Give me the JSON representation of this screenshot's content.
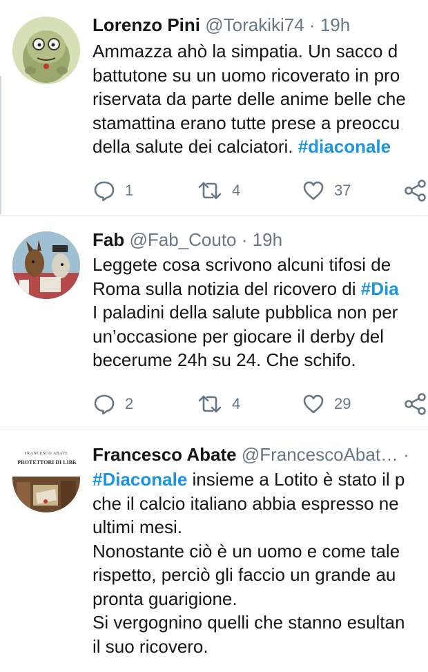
{
  "tweets": [
    {
      "name": "Lorenzo Pini",
      "handle": "@Torakiki74",
      "sep": "·",
      "time": "19h",
      "lines": [
        [
          "Ammazza ahò la simpatia. Un sacco d"
        ],
        [
          "battutone su un uomo ricoverato in pro"
        ],
        [
          "riservata da parte delle anime belle che"
        ],
        [
          "stamattina erano tutte prese a preoccu"
        ],
        [
          "della salute dei calciatori. ",
          "#diaconale"
        ]
      ],
      "replies": "1",
      "retweets": "4",
      "likes": "37"
    },
    {
      "name": "Fab",
      "handle": "@Fab_Couto",
      "sep": "·",
      "time": "19h",
      "lines": [
        [
          "Leggete cosa scrivono alcuni tifosi de"
        ],
        [
          "Roma sulla notizia del ricovero di ",
          "#Dia"
        ],
        [
          "I paladini della salute pubblica non per"
        ],
        [
          "un’occasione per giocare il derby del"
        ],
        [
          "becerume 24h su 24. Che schifo."
        ]
      ],
      "replies": "2",
      "retweets": "4",
      "likes": "29"
    },
    {
      "name": "Francesco Abate",
      "handle": "@FrancescoAbat…",
      "sep": "·",
      "avatar_text": [
        "FRANCESCO ABATE",
        "I PROTETTORI DI LIBRI"
      ],
      "lines": [
        [
          "",
          "#Diaconale",
          " insieme a Lotito è stato il p"
        ],
        [
          "che il calcio italiano abbia espresso ne"
        ],
        [
          "ultimi mesi."
        ],
        [
          "Nonostante ciò è un uomo e come tale"
        ],
        [
          "rispetto, perciò gli faccio un grande au"
        ],
        [
          "pronta guarigione."
        ],
        [
          "Si vergognino quelli che stanno esultan"
        ],
        [
          "il suo ricovero."
        ]
      ]
    }
  ],
  "colors": {
    "link": "#1b95e0",
    "secondary": "#657786",
    "divider": "#e1e8ed"
  },
  "icons": [
    "reply-icon",
    "retweet-icon",
    "like-icon",
    "share-icon"
  ]
}
